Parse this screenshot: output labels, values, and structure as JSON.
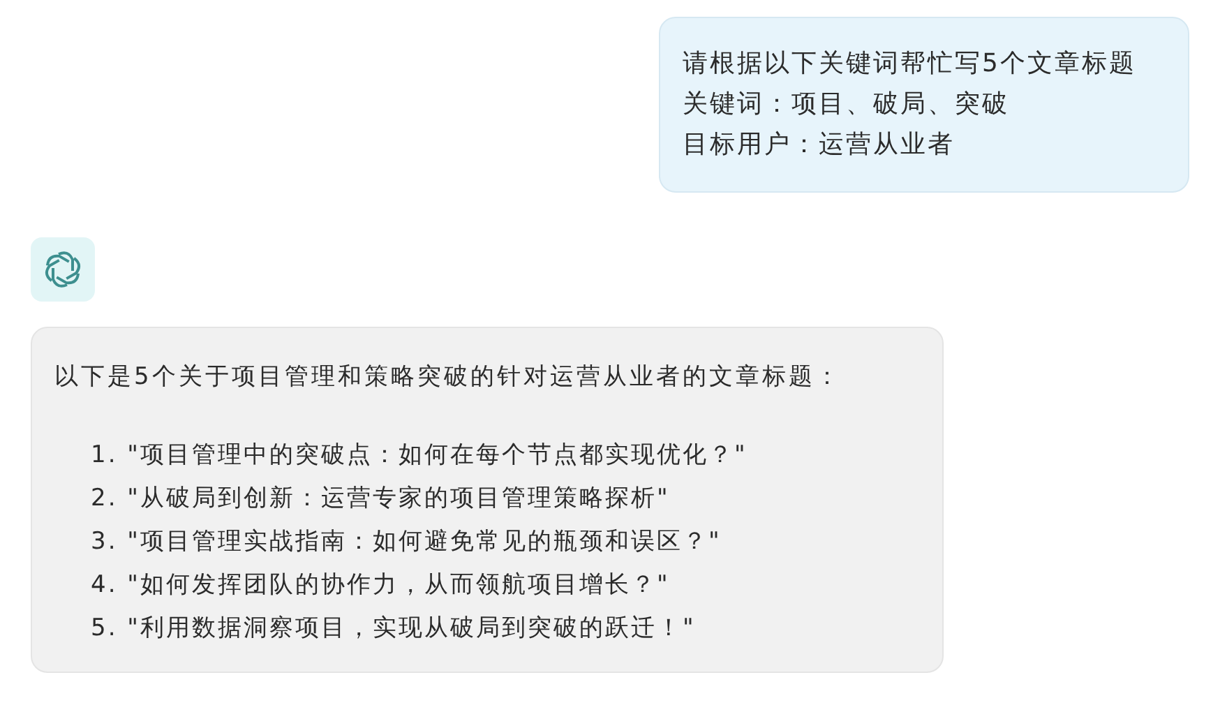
{
  "messages": [
    {
      "kind": "user",
      "lines": [
        "请根据以下关键词帮忙写5个文章标题",
        "关键词：项目、破局、突破",
        "目标用户：运营从业者"
      ]
    },
    {
      "kind": "assistant",
      "intro": "以下是5个关于项目管理和策略突破的针对运营从业者的文章标题：",
      "items": [
        {
          "number": "1.",
          "text": "\"项目管理中的突破点：如何在每个节点都实现优化？\""
        },
        {
          "number": "2.",
          "text": "\"从破局到创新：运营专家的项目管理策略探析\""
        },
        {
          "number": "3.",
          "text": "\"项目管理实战指南：如何避免常见的瓶颈和误区？\""
        },
        {
          "number": "4.",
          "text": "\"如何发挥团队的协作力，从而领航项目增长？\""
        },
        {
          "number": "5.",
          "text": "\"利用数据洞察项目，实现从破局到突破的跃迁！\""
        }
      ]
    }
  ]
}
